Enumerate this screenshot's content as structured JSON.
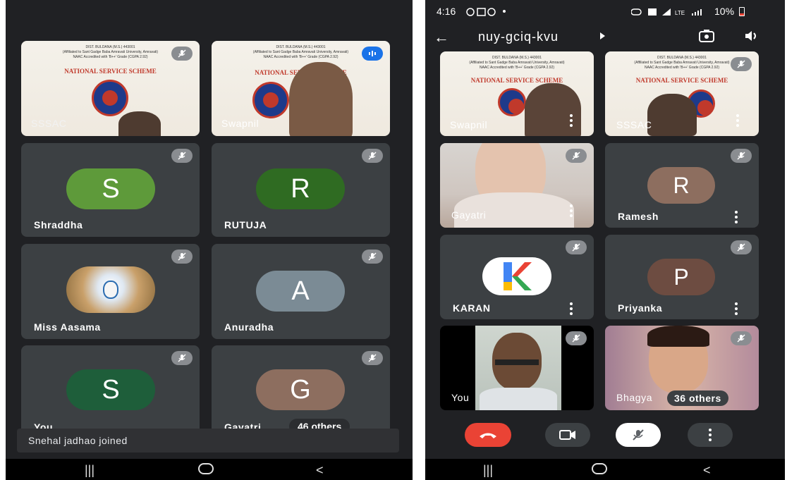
{
  "left": {
    "tiles": [
      {
        "name": "SSSAC"
      },
      {
        "name": "Swapnil"
      },
      {
        "name": "Shraddha",
        "initial": "S",
        "color": "#5e9a3a"
      },
      {
        "name": "RUTUJA",
        "initial": "R",
        "color": "#2f6b22"
      },
      {
        "name": "Miss Aasama"
      },
      {
        "name": "Anuradha",
        "initial": "A",
        "color": "#7b8b95"
      },
      {
        "name": "You",
        "initial": "S",
        "color": "#1e5e3a"
      },
      {
        "name": "Gayatri",
        "initial": "G",
        "color": "#8d6e5f"
      }
    ],
    "others": "46 others",
    "toast": "Snehal jadhao joined"
  },
  "right": {
    "status": {
      "time": "4:16",
      "battery": "10%"
    },
    "meeting_code": "nuy-gciq-kvu",
    "tiles": [
      {
        "name": "Swapnil"
      },
      {
        "name": "SSSAC"
      },
      {
        "name": "Gayatri"
      },
      {
        "name": "Ramesh",
        "initial": "R",
        "color": "#8d6e5f"
      },
      {
        "name": "KARAN",
        "initial": "K"
      },
      {
        "name": "Priyanka",
        "initial": "P",
        "color": "#6d4c41"
      },
      {
        "name": "You"
      },
      {
        "name": "Bhagya"
      }
    ],
    "others": "36 others"
  },
  "poster": {
    "line1": "DIST. BULDANA (M.S.) 443001",
    "line2": "(Affiliated to Sant Gadge Baba Amravati University, Amravati)",
    "line3": "NAAC Accredited with 'B++' Grade (CGPA 2.92)",
    "title": "NATIONAL SERVICE SCHEME"
  },
  "colors": {
    "bg": "#202124",
    "tile": "#3c4043",
    "end_call": "#ea4335"
  }
}
